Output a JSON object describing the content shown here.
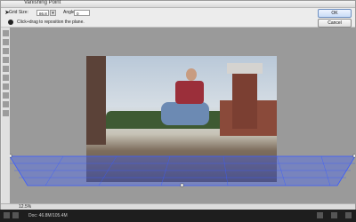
{
  "dialog": {
    "title": "Vanishing Point",
    "ok_label": "OK",
    "cancel_label": "Cancel"
  },
  "toolbar": {
    "grid_size_label": "Grid Size:",
    "grid_size_value": "86.8 px",
    "angle_label": "Angle:",
    "angle_value": "0"
  },
  "hint": {
    "text": "Click+drag to reposition the plane."
  },
  "statusbar": {
    "zoom": "12.5%"
  },
  "taskbar": {
    "doc_info": "Doc: 46.8M/105.4M"
  },
  "colors": {
    "plane_grid": "#3a5cff",
    "ok_button": "#c9dbf6"
  },
  "icons": [
    "edit-plane-icon",
    "create-plane-icon",
    "marquee-icon",
    "stamp-icon",
    "brush-icon",
    "transform-icon",
    "eyedropper-icon",
    "measure-icon",
    "hand-icon",
    "zoom-icon"
  ]
}
